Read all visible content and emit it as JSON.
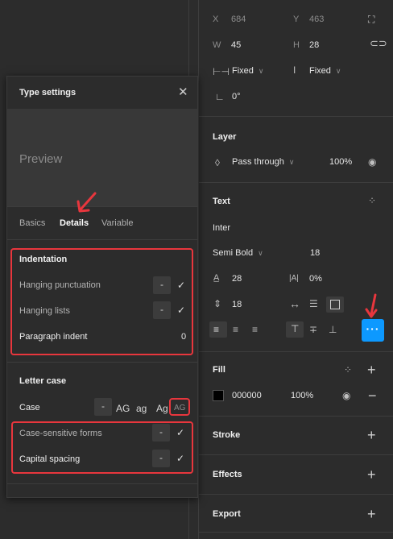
{
  "right_panel": {
    "x_label": "X",
    "x_value": "684",
    "y_label": "Y",
    "y_value": "463",
    "w_label": "W",
    "w_value": "45",
    "h_label": "H",
    "h_value": "28",
    "width_mode": "Fixed",
    "height_mode": "Fixed",
    "rotation": "0°",
    "layer": {
      "title": "Layer",
      "blend": "Pass through",
      "opacity": "100%"
    },
    "text": {
      "title": "Text",
      "font": "Inter",
      "weight": "Semi Bold",
      "size": "18",
      "line_height": "28",
      "letter_spacing": "0%",
      "paragraph_spacing": "18"
    },
    "fill": {
      "title": "Fill",
      "hex": "000000",
      "opacity": "100%"
    },
    "stroke_title": "Stroke",
    "effects_title": "Effects",
    "export_title": "Export",
    "more_button": "···"
  },
  "modal": {
    "title": "Type settings",
    "preview": "Preview",
    "tabs": [
      "Basics",
      "Details",
      "Variable"
    ],
    "indentation": {
      "heading": "Indentation",
      "hanging_punctuation": "Hanging punctuation",
      "hanging_lists": "Hanging lists",
      "paragraph_indent": "Paragraph indent",
      "paragraph_indent_value": "0"
    },
    "letter_case": {
      "heading": "Letter case",
      "case_label": "Case",
      "options": [
        "-",
        "AG",
        "ag",
        "Ag",
        "AG"
      ],
      "case_sensitive": "Case-sensitive forms",
      "capital_spacing": "Capital spacing"
    },
    "minus": "-"
  },
  "colors": {
    "accent": "#0d99ff",
    "highlight": "#e8363d"
  }
}
